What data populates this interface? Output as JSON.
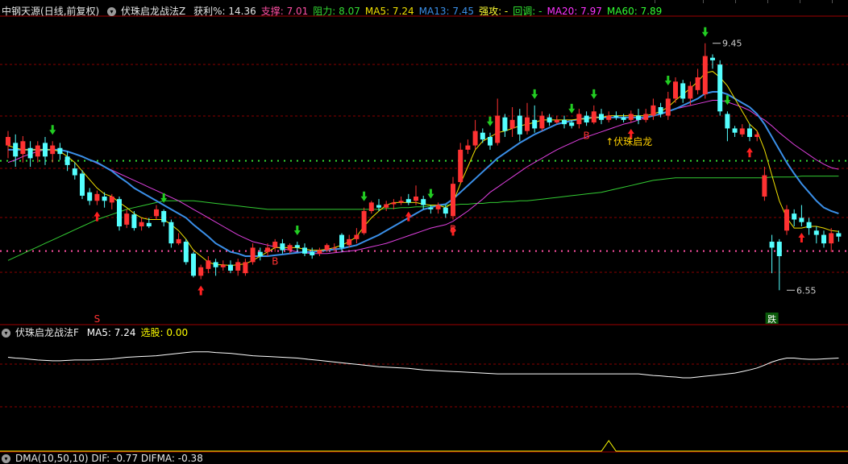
{
  "main_header": {
    "stock_name": "中钢天源",
    "period_label": "(日线,前复权)",
    "indicator_name": "伏珠启龙战法Z",
    "fields": [
      {
        "label": "获利%",
        "value": "14.36",
        "color": "#e6e6e6"
      },
      {
        "label": "支撑",
        "value": "7.01",
        "color": "#ff4fa3"
      },
      {
        "label": "阻力",
        "value": "8.07",
        "color": "#33dd33"
      },
      {
        "label": "MA5",
        "value": "7.24",
        "color": "#f0e000"
      },
      {
        "label": "MA13",
        "value": "7.45",
        "color": "#3a8fe8"
      },
      {
        "label": "强攻",
        "value": "-",
        "color": "#ffff33"
      },
      {
        "label": "回调",
        "value": "-",
        "color": "#33ee33"
      },
      {
        "label": "MA20",
        "value": "7.97",
        "color": "#ff33ff"
      },
      {
        "label": "MA60",
        "value": "7.89",
        "color": "#33ff33"
      }
    ]
  },
  "sub_header": {
    "indicator_name": "伏珠启龙战法F",
    "fields": [
      {
        "label": "MA5",
        "value": "7.24",
        "color": "#ffffff"
      },
      {
        "label": "选股",
        "value": "0.00",
        "color": "#ffff00"
      }
    ]
  },
  "bottom_header": {
    "text": "DMA(10,50,10)  DIF: -0.77  DIFMA: -0.38"
  },
  "annotations": {
    "high_label": "9.45",
    "low_label": "6.55",
    "signal_text": "↑伏珠启龙",
    "buy_mark": "B",
    "sell_mark": "S",
    "fall_mark": "跌"
  },
  "colors": {
    "up": "#ff3232",
    "down": "#54ffff",
    "ma5": "#f0e000",
    "ma13": "#3a8fe8",
    "ma20": "#e040e0",
    "ma60": "#33cc33",
    "support": "#ff4fa3",
    "resist": "#33dd33",
    "grid_red": "#8a0000",
    "buy_arrow": "#ff2020",
    "sell_arrow": "#22cc22"
  },
  "chart_data": {
    "type": "candlestick",
    "ylim": [
      6.25,
      9.75
    ],
    "high": 9.45,
    "low": 6.55,
    "support": 7.01,
    "resistance": 8.07,
    "candles": [
      [
        8.25,
        8.35,
        8.42,
        8.1
      ],
      [
        8.28,
        8.12,
        8.38,
        8.0
      ],
      [
        8.15,
        8.3,
        8.36,
        8.05
      ],
      [
        8.22,
        8.1,
        8.3,
        8.0
      ],
      [
        8.12,
        8.25,
        8.3,
        8.05
      ],
      [
        8.28,
        8.12,
        8.35,
        8.02
      ],
      [
        8.15,
        8.25,
        8.3,
        8.05
      ],
      [
        8.22,
        8.15,
        8.28,
        8.08
      ],
      [
        8.12,
        8.02,
        8.18,
        7.95
      ],
      [
        7.98,
        7.9,
        8.05,
        7.85
      ],
      [
        7.92,
        7.66,
        7.96,
        7.62
      ],
      [
        7.7,
        7.6,
        7.75,
        7.55
      ],
      [
        7.6,
        7.68,
        7.72,
        7.55
      ],
      [
        7.65,
        7.6,
        7.7,
        7.52
      ],
      [
        7.58,
        7.65,
        7.68,
        7.5
      ],
      [
        7.62,
        7.3,
        7.65,
        7.25
      ],
      [
        7.32,
        7.45,
        7.5,
        7.28
      ],
      [
        7.44,
        7.28,
        7.48,
        7.25
      ],
      [
        7.3,
        7.35,
        7.4,
        7.25
      ],
      [
        7.34,
        7.3,
        7.4,
        7.28
      ],
      [
        7.42,
        7.5,
        7.55,
        7.38
      ],
      [
        7.48,
        7.35,
        7.5,
        7.3
      ],
      [
        7.35,
        7.1,
        7.38,
        7.05
      ],
      [
        7.1,
        7.15,
        7.22,
        7.08
      ],
      [
        7.12,
        6.88,
        7.15,
        6.85
      ],
      [
        6.98,
        6.72,
        7.0,
        6.7
      ],
      [
        6.72,
        6.82,
        6.85,
        6.68
      ],
      [
        6.8,
        6.9,
        6.95,
        6.75
      ],
      [
        6.88,
        6.82,
        6.92,
        6.72
      ],
      [
        6.82,
        6.85,
        6.9,
        6.78
      ],
      [
        6.85,
        6.78,
        6.9,
        6.75
      ],
      [
        6.78,
        6.88,
        6.92,
        6.72
      ],
      [
        6.75,
        6.88,
        6.92,
        6.72
      ],
      [
        6.88,
        7.05,
        7.1,
        6.85
      ],
      [
        7.0,
        6.95,
        7.05,
        6.9
      ],
      [
        7.0,
        7.05,
        7.1,
        6.95
      ],
      [
        7.05,
        7.12,
        7.15,
        7.0
      ],
      [
        7.1,
        7.02,
        7.15,
        6.98
      ],
      [
        7.02,
        7.08,
        7.1,
        6.98
      ],
      [
        7.08,
        7.05,
        7.12,
        7.0
      ],
      [
        7.05,
        6.98,
        7.1,
        6.95
      ],
      [
        7.0,
        6.96,
        7.05,
        6.92
      ],
      [
        6.98,
        7.02,
        7.05,
        6.95
      ],
      [
        7.02,
        7.08,
        7.1,
        7.0
      ],
      [
        7.05,
        7.05,
        7.1,
        7.0
      ],
      [
        7.2,
        7.05,
        7.22,
        7.0
      ],
      [
        7.08,
        7.15,
        7.2,
        7.05
      ],
      [
        7.15,
        7.2,
        7.28,
        7.1
      ],
      [
        7.22,
        7.48,
        7.52,
        7.2
      ],
      [
        7.48,
        7.58,
        7.6,
        7.45
      ],
      [
        7.55,
        7.52,
        7.62,
        7.48
      ],
      [
        7.52,
        7.56,
        7.6,
        7.48
      ],
      [
        7.56,
        7.58,
        7.62,
        7.5
      ],
      [
        7.58,
        7.6,
        7.65,
        7.55
      ],
      [
        7.62,
        7.58,
        7.68,
        7.55
      ],
      [
        7.6,
        7.65,
        7.78,
        7.55
      ],
      [
        7.62,
        7.55,
        7.66,
        7.5
      ],
      [
        7.52,
        7.5,
        7.55,
        7.45
      ],
      [
        7.5,
        7.55,
        7.58,
        7.45
      ],
      [
        7.52,
        7.45,
        7.55,
        7.4
      ],
      [
        7.42,
        7.8,
        7.88,
        7.38
      ],
      [
        7.82,
        8.2,
        8.28,
        7.8
      ],
      [
        8.2,
        8.25,
        8.32,
        8.15
      ],
      [
        8.25,
        8.42,
        8.55,
        8.2
      ],
      [
        8.4,
        8.32,
        8.45,
        8.28
      ],
      [
        8.35,
        8.25,
        8.4,
        8.2
      ],
      [
        8.28,
        8.6,
        8.8,
        8.25
      ],
      [
        8.58,
        8.42,
        8.62,
        8.35
      ],
      [
        8.45,
        8.55,
        8.7,
        8.35
      ],
      [
        8.6,
        8.38,
        8.68,
        8.3
      ],
      [
        8.42,
        8.58,
        8.75,
        8.38
      ],
      [
        8.55,
        8.45,
        8.72,
        8.4
      ],
      [
        8.45,
        8.6,
        8.65,
        8.42
      ],
      [
        8.58,
        8.52,
        8.62,
        8.48
      ],
      [
        8.52,
        8.55,
        8.6,
        8.5
      ],
      [
        8.55,
        8.5,
        8.6,
        8.45
      ],
      [
        8.52,
        8.48,
        8.55,
        8.45
      ],
      [
        8.5,
        8.62,
        8.68,
        8.45
      ],
      [
        8.6,
        8.52,
        8.65,
        8.48
      ],
      [
        8.52,
        8.65,
        8.72,
        8.5
      ],
      [
        8.62,
        8.55,
        8.68,
        8.5
      ],
      [
        8.55,
        8.6,
        8.65,
        8.52
      ],
      [
        8.6,
        8.58,
        8.65,
        8.55
      ],
      [
        8.58,
        8.55,
        8.62,
        8.52
      ],
      [
        8.55,
        8.62,
        8.66,
        8.52
      ],
      [
        8.6,
        8.55,
        8.68,
        8.5
      ],
      [
        8.55,
        8.62,
        8.68,
        8.52
      ],
      [
        8.6,
        8.72,
        8.8,
        8.55
      ],
      [
        8.7,
        8.62,
        8.75,
        8.58
      ],
      [
        8.6,
        8.8,
        8.88,
        8.55
      ],
      [
        8.8,
        9.0,
        9.05,
        8.75
      ],
      [
        8.98,
        8.8,
        9.02,
        8.75
      ],
      [
        8.8,
        8.95,
        9.0,
        8.72
      ],
      [
        8.9,
        9.05,
        9.15,
        8.85
      ],
      [
        8.85,
        9.3,
        9.45,
        8.8
      ],
      [
        9.28,
        9.25,
        9.32,
        9.15
      ],
      [
        9.2,
        8.65,
        9.25,
        8.6
      ],
      [
        8.62,
        8.45,
        8.65,
        8.3
      ],
      [
        8.45,
        8.4,
        8.48,
        8.35
      ],
      [
        8.38,
        8.45,
        8.5,
        8.35
      ],
      [
        8.45,
        8.35,
        8.5,
        8.3
      ],
      [
        8.35,
        8.38,
        8.42,
        8.3
      ],
      [
        7.65,
        7.9,
        8.0,
        7.6
      ],
      [
        7.12,
        7.05,
        7.2,
        6.75
      ],
      [
        7.12,
        6.95,
        7.15,
        6.55
      ],
      [
        7.25,
        7.5,
        7.55,
        7.2
      ],
      [
        7.45,
        7.38,
        7.5,
        7.3
      ],
      [
        7.4,
        7.35,
        7.55,
        7.3
      ],
      [
        7.35,
        7.28,
        7.4,
        7.2
      ],
      [
        7.25,
        7.2,
        7.3,
        7.1
      ],
      [
        7.2,
        7.1,
        7.25,
        7.05
      ],
      [
        7.1,
        7.22,
        7.28,
        7.0
      ],
      [
        7.22,
        7.18,
        7.25,
        7.12
      ]
    ],
    "ma5": [
      8.25,
      8.22,
      8.2,
      8.2,
      8.2,
      8.2,
      8.2,
      8.18,
      8.12,
      8.05,
      7.95,
      7.85,
      7.75,
      7.68,
      7.65,
      7.58,
      7.52,
      7.45,
      7.4,
      7.38,
      7.38,
      7.38,
      7.32,
      7.25,
      7.15,
      7.02,
      6.95,
      6.88,
      6.85,
      6.85,
      6.84,
      6.85,
      6.86,
      6.9,
      6.95,
      7.0,
      7.05,
      7.05,
      7.05,
      7.05,
      7.03,
      7.02,
      7.02,
      7.03,
      7.05,
      7.08,
      7.12,
      7.18,
      7.3,
      7.4,
      7.48,
      7.55,
      7.58,
      7.58,
      7.58,
      7.58,
      7.56,
      7.55,
      7.55,
      7.52,
      7.58,
      7.8,
      8.0,
      8.2,
      8.3,
      8.35,
      8.4,
      8.42,
      8.45,
      8.48,
      8.5,
      8.52,
      8.55,
      8.55,
      8.55,
      8.55,
      8.55,
      8.56,
      8.56,
      8.58,
      8.58,
      8.6,
      8.6,
      8.6,
      8.6,
      8.6,
      8.6,
      8.62,
      8.65,
      8.7,
      8.78,
      8.85,
      8.92,
      9.0,
      9.1,
      9.12,
      9.05,
      8.95,
      8.8,
      8.65,
      8.5,
      8.42,
      8.2,
      7.9,
      7.6,
      7.4,
      7.28,
      7.28,
      7.3,
      7.3,
      7.28,
      7.25,
      7.24
    ],
    "ma13": [
      8.2,
      8.2,
      8.2,
      8.2,
      8.2,
      8.2,
      8.2,
      8.2,
      8.18,
      8.15,
      8.12,
      8.08,
      8.05,
      8.0,
      7.95,
      7.88,
      7.82,
      7.75,
      7.7,
      7.65,
      7.6,
      7.55,
      7.5,
      7.45,
      7.4,
      7.32,
      7.25,
      7.18,
      7.1,
      7.05,
      7.0,
      6.98,
      6.95,
      6.95,
      6.95,
      6.95,
      6.96,
      6.97,
      6.98,
      6.99,
      7.0,
      7.0,
      7.01,
      7.02,
      7.03,
      7.04,
      7.06,
      7.08,
      7.12,
      7.16,
      7.2,
      7.25,
      7.3,
      7.35,
      7.4,
      7.45,
      7.5,
      7.52,
      7.55,
      7.56,
      7.62,
      7.7,
      7.78,
      7.86,
      7.94,
      8.02,
      8.1,
      8.16,
      8.22,
      8.28,
      8.33,
      8.38,
      8.42,
      8.46,
      8.5,
      8.52,
      8.54,
      8.56,
      8.57,
      8.58,
      8.58,
      8.58,
      8.58,
      8.58,
      8.58,
      8.58,
      8.58,
      8.6,
      8.62,
      8.65,
      8.68,
      8.72,
      8.76,
      8.8,
      8.86,
      8.88,
      8.88,
      8.85,
      8.8,
      8.75,
      8.7,
      8.62,
      8.5,
      8.35,
      8.2,
      8.05,
      7.92,
      7.8,
      7.7,
      7.6,
      7.52,
      7.48,
      7.45
    ],
    "ma20": [
      8.05,
      8.08,
      8.12,
      8.15,
      8.18,
      8.2,
      8.2,
      8.2,
      8.18,
      8.15,
      8.12,
      8.08,
      8.04,
      8.0,
      7.96,
      7.92,
      7.88,
      7.84,
      7.8,
      7.76,
      7.72,
      7.68,
      7.64,
      7.6,
      7.55,
      7.5,
      7.45,
      7.4,
      7.35,
      7.3,
      7.25,
      7.2,
      7.16,
      7.12,
      7.1,
      7.08,
      7.06,
      7.04,
      7.02,
      7.0,
      6.99,
      6.98,
      6.98,
      6.98,
      6.99,
      7.0,
      7.01,
      7.02,
      7.04,
      7.06,
      7.08,
      7.1,
      7.13,
      7.16,
      7.19,
      7.22,
      7.25,
      7.28,
      7.3,
      7.32,
      7.36,
      7.42,
      7.48,
      7.55,
      7.62,
      7.7,
      7.76,
      7.82,
      7.88,
      7.94,
      8.0,
      8.05,
      8.1,
      8.15,
      8.2,
      8.24,
      8.28,
      8.32,
      8.35,
      8.38,
      8.41,
      8.44,
      8.47,
      8.5,
      8.52,
      8.55,
      8.57,
      8.6,
      8.62,
      8.65,
      8.68,
      8.7,
      8.72,
      8.74,
      8.76,
      8.78,
      8.78,
      8.76,
      8.73,
      8.7,
      8.66,
      8.6,
      8.55,
      8.48,
      8.4,
      8.33,
      8.26,
      8.2,
      8.14,
      8.08,
      8.03,
      7.99,
      7.97
    ],
    "ma60": [
      6.9,
      6.94,
      6.98,
      7.02,
      7.06,
      7.1,
      7.14,
      7.18,
      7.22,
      7.26,
      7.3,
      7.34,
      7.38,
      7.41,
      7.44,
      7.47,
      7.5,
      7.52,
      7.54,
      7.56,
      7.58,
      7.6,
      7.6,
      7.6,
      7.6,
      7.6,
      7.59,
      7.58,
      7.57,
      7.56,
      7.55,
      7.54,
      7.53,
      7.52,
      7.51,
      7.5,
      7.5,
      7.5,
      7.5,
      7.5,
      7.5,
      7.5,
      7.5,
      7.5,
      7.5,
      7.5,
      7.5,
      7.5,
      7.5,
      7.5,
      7.5,
      7.51,
      7.51,
      7.52,
      7.52,
      7.53,
      7.53,
      7.54,
      7.54,
      7.55,
      7.55,
      7.56,
      7.56,
      7.57,
      7.57,
      7.58,
      7.58,
      7.59,
      7.59,
      7.6,
      7.6,
      7.61,
      7.62,
      7.63,
      7.64,
      7.65,
      7.66,
      7.67,
      7.68,
      7.69,
      7.7,
      7.72,
      7.74,
      7.76,
      7.78,
      7.8,
      7.82,
      7.84,
      7.85,
      7.86,
      7.87,
      7.87,
      7.87,
      7.87,
      7.87,
      7.87,
      7.87,
      7.87,
      7.87,
      7.87,
      7.87,
      7.87,
      7.87,
      7.88,
      7.88,
      7.88,
      7.88,
      7.89,
      7.89,
      7.89,
      7.89,
      7.89,
      7.89
    ],
    "sub_series": [
      0.52,
      0.5,
      0.49,
      0.47,
      0.45,
      0.44,
      0.43,
      0.43,
      0.44,
      0.45,
      0.45,
      0.45,
      0.46,
      0.47,
      0.48,
      0.5,
      0.52,
      0.53,
      0.54,
      0.55,
      0.56,
      0.58,
      0.6,
      0.62,
      0.64,
      0.66,
      0.66,
      0.66,
      0.64,
      0.63,
      0.62,
      0.6,
      0.58,
      0.56,
      0.55,
      0.54,
      0.53,
      0.52,
      0.51,
      0.5,
      0.48,
      0.46,
      0.44,
      0.42,
      0.4,
      0.38,
      0.36,
      0.34,
      0.32,
      0.3,
      0.28,
      0.27,
      0.26,
      0.25,
      0.24,
      0.22,
      0.2,
      0.19,
      0.18,
      0.17,
      0.16,
      0.15,
      0.14,
      0.13,
      0.12,
      0.11,
      0.1,
      0.1,
      0.1,
      0.1,
      0.1,
      0.1,
      0.1,
      0.1,
      0.1,
      0.1,
      0.1,
      0.1,
      0.1,
      0.1,
      0.1,
      0.1,
      0.1,
      0.1,
      0.1,
      0.1,
      0.08,
      0.06,
      0.05,
      0.03,
      0.02,
      0.0,
      0.0,
      0.02,
      0.04,
      0.06,
      0.08,
      0.1,
      0.12,
      0.16,
      0.2,
      0.25,
      0.32,
      0.4,
      0.46,
      0.5,
      0.5,
      0.48,
      0.47,
      0.47,
      0.48,
      0.49,
      0.5
    ],
    "buy_arrows": [
      12,
      26,
      54,
      60,
      84,
      100,
      107
    ],
    "sell_arrows": [
      6,
      21,
      39,
      48,
      57,
      65,
      71,
      76,
      79,
      89,
      94,
      97
    ],
    "b_marks": [
      36,
      60,
      78
    ],
    "s_marks": [
      12
    ],
    "fall_marks": [
      103
    ],
    "signal_index": 81,
    "high_index": 95,
    "low_index": 105,
    "sub_trigger_index": 81
  }
}
